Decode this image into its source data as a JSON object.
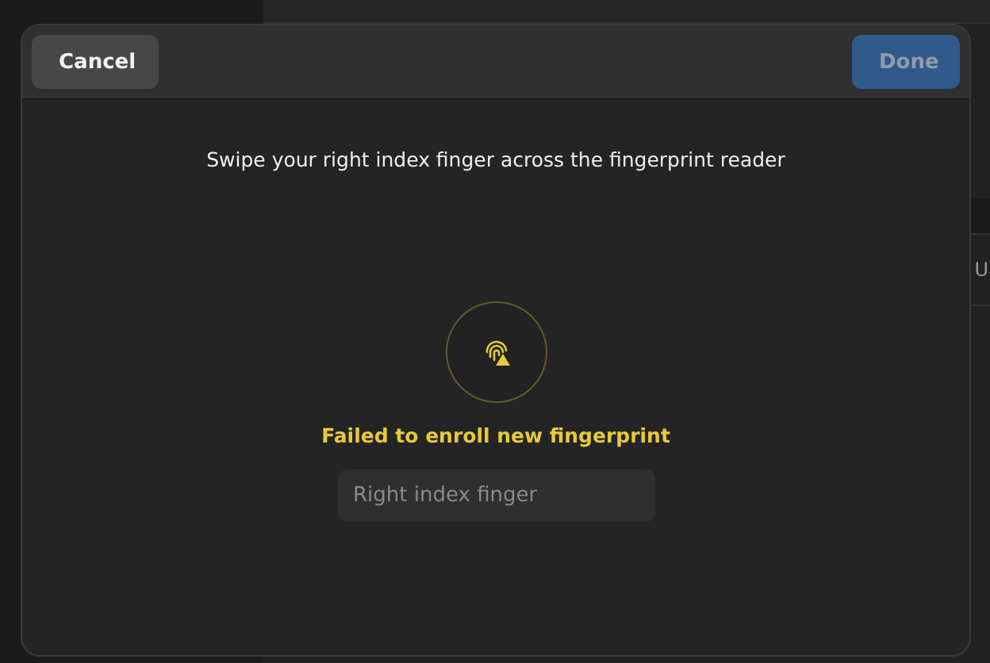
{
  "background": {
    "peek_text": "U"
  },
  "dialog": {
    "cancel_button": {
      "label": "Cancel"
    },
    "done_button": {
      "label": "Done",
      "disabled": true
    },
    "instruction": "Swipe your right index finger across the fingerprint reader",
    "status": {
      "kind": "error",
      "text": "Failed to enroll new fingerprint"
    },
    "name_field": {
      "placeholder": "Right index finger"
    }
  }
}
